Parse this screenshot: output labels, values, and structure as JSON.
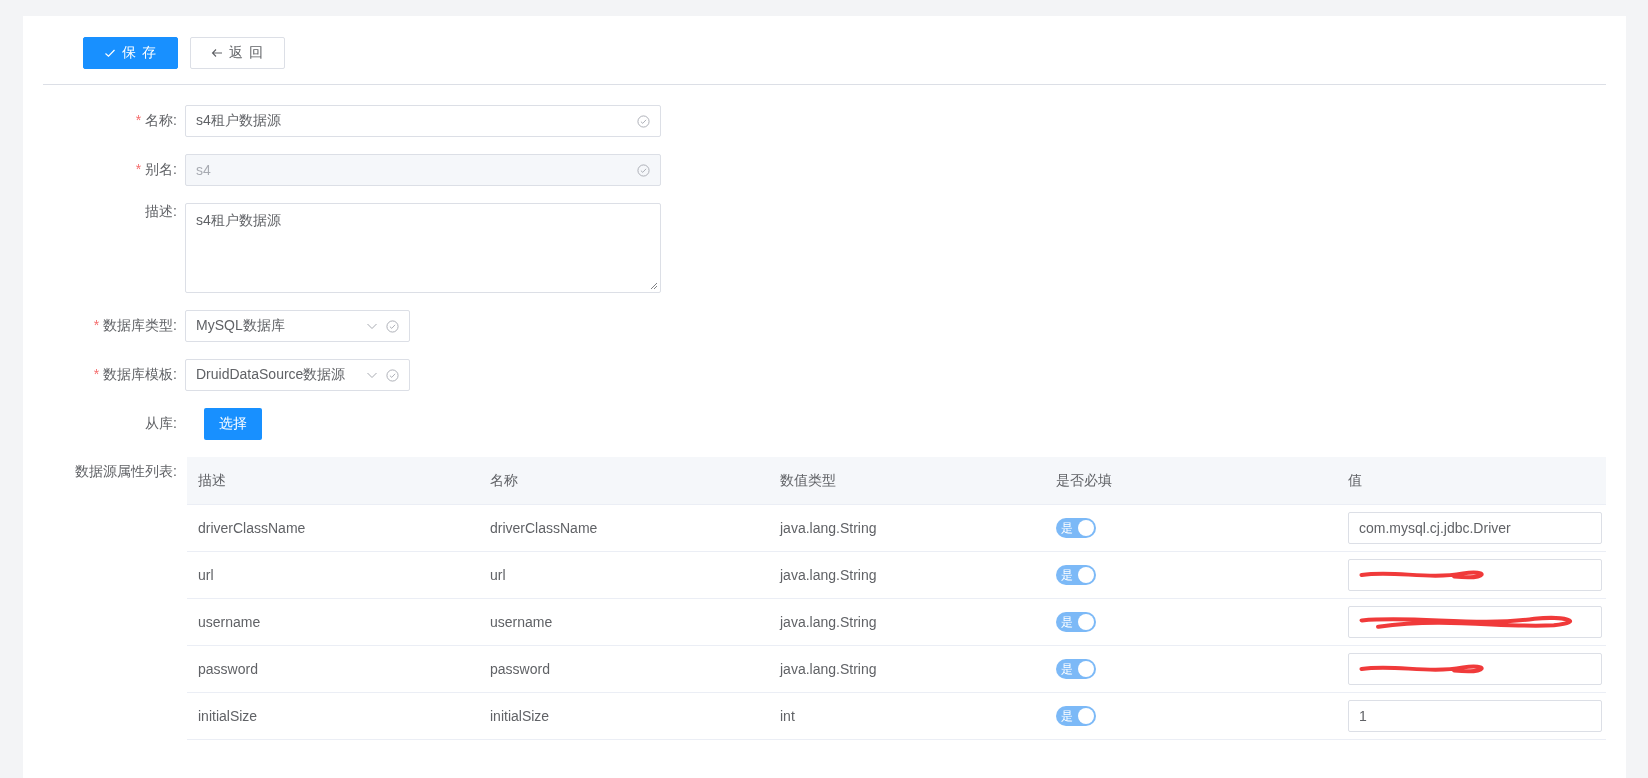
{
  "toolbar": {
    "buttons": [
      {
        "label": "保 存",
        "kind": "primary"
      },
      {
        "label": "返 回",
        "kind": "back"
      }
    ]
  },
  "form": {
    "fields": [
      {
        "label": "名称:",
        "required_mark": "*",
        "kind": "input",
        "value": "s4租户数据源",
        "disabled": false,
        "valid": true
      },
      {
        "label": "别名:",
        "required_mark": "*",
        "kind": "input",
        "value": "s4",
        "disabled": true,
        "valid": true
      },
      {
        "label": "描述:",
        "kind": "textarea",
        "value": "s4租户数据源"
      },
      {
        "label": "数据库类型:",
        "required_mark": "*",
        "kind": "select",
        "value": "MySQL数据库",
        "valid": true
      },
      {
        "label": "数据库模板:",
        "required_mark": "*",
        "kind": "select",
        "value": "DruidDataSource数据源",
        "valid": true
      },
      {
        "label": "从库:",
        "kind": "button",
        "value": "选择"
      }
    ]
  },
  "properties": {
    "label": "数据源属性列表:",
    "columns": [
      "描述",
      "名称",
      "数值类型",
      "是否必填",
      "值"
    ],
    "rows": [
      {
        "description": "driverClassName",
        "name": "driverClassName",
        "type": "java.lang.String",
        "required": {
          "label": "是",
          "on": true
        },
        "value": "com.mysql.cj.jdbc.Driver",
        "redacted": false
      },
      {
        "description": "url",
        "name": "url",
        "type": "java.lang.String",
        "required": {
          "label": "是",
          "on": true
        },
        "redacted": true
      },
      {
        "description": "username",
        "name": "username",
        "type": "java.lang.String",
        "required": {
          "label": "是",
          "on": true
        },
        "redacted": true
      },
      {
        "description": "password",
        "name": "password",
        "type": "java.lang.String",
        "required": {
          "label": "是",
          "on": true
        },
        "redacted": true
      },
      {
        "description": "initialSize",
        "name": "initialSize",
        "type": "int",
        "required": {
          "label": "是",
          "on": true
        },
        "value": "1",
        "redacted": false
      }
    ]
  }
}
